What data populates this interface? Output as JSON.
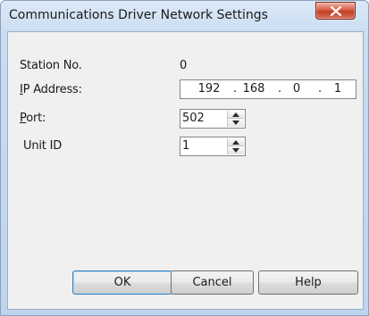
{
  "window": {
    "title": "Communications Driver Network Settings"
  },
  "fields": {
    "station_label": "Station No.",
    "station_value": "0",
    "ip_label_mnemonic": "I",
    "ip_label_rest": "P Address:",
    "ip_octets": [
      "192",
      "168",
      "0",
      "1"
    ],
    "port_label_mnemonic": "P",
    "port_label_rest": "ort:",
    "port_value": "502",
    "unit_label": "Unit ID",
    "unit_value": "1"
  },
  "buttons": {
    "ok": "OK",
    "cancel": "Cancel",
    "help": "Help"
  },
  "icons": {
    "close": "close-icon",
    "spin_up": "arrow-up-icon",
    "spin_down": "arrow-down-icon"
  },
  "colors": {
    "close_button": "#c9452c",
    "title_bar": "#c9dcf2",
    "client_bg": "#f0f0f0"
  }
}
